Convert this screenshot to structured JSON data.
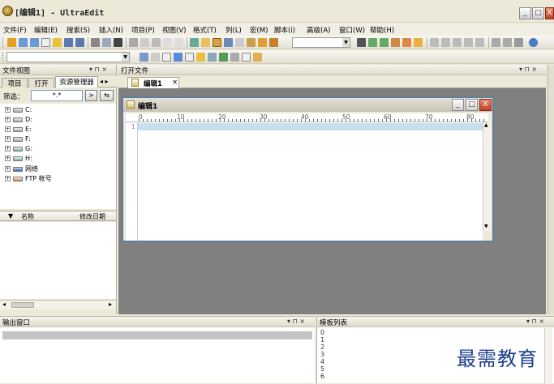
{
  "window": {
    "title": "[编辑1] - UltraEdit",
    "controls": [
      "_",
      "□",
      "X"
    ]
  },
  "menu": [
    "文件(F)",
    "编辑(E)",
    "搜索(S)",
    "插入(N)",
    "项目(P)",
    "视图(V)",
    "格式(T)",
    "列(L)",
    "宏(M)",
    "脚本(i)",
    "高级(A)",
    "窗口(W)",
    "帮助(H)"
  ],
  "file_view": {
    "title": "文件视图",
    "pin": "▾ ⊓ ×",
    "tabs": [
      "项目",
      "打开",
      "资源管理器"
    ],
    "tab_arrows": "◂ ▸",
    "filter_label": "筛选：",
    "filter_value": "*.*",
    "filter_go": ">",
    "filter_browse": "⇆",
    "tree": [
      {
        "label": "C:",
        "icon": "drive-icon"
      },
      {
        "label": "D:",
        "icon": "drive-icon"
      },
      {
        "label": "E:",
        "icon": "drive-icon"
      },
      {
        "label": "F:",
        "icon": "drive-icon"
      },
      {
        "label": "G:",
        "icon": "cd-drive-icon"
      },
      {
        "label": "H:",
        "icon": "cd-drive-icon"
      },
      {
        "label": "网络",
        "icon": "network-icon"
      },
      {
        "label": "FTP 帐号",
        "icon": "ftp-icon"
      }
    ],
    "list_headers": [
      "▼",
      "名称",
      "修改日期"
    ],
    "hscroll": [
      "◂",
      "▸"
    ]
  },
  "open_files": {
    "title": "打开文件",
    "pin": "▾ ⊓ ×",
    "tab_label": "编辑1",
    "tab_close": "×"
  },
  "editor": {
    "title": "编辑1",
    "controls": [
      "_",
      "□",
      "X"
    ],
    "ruler": [
      "0",
      "10",
      "20",
      "30",
      "40",
      "50",
      "60",
      "70",
      "80"
    ],
    "lines": [
      "1"
    ]
  },
  "output": {
    "title": "输出窗口",
    "pin": "▾ ⊓ ×"
  },
  "templates": {
    "title": "模板列表",
    "pin": "▾ ⊓ ×",
    "items": [
      "0",
      "1",
      "2",
      "3",
      "4",
      "5",
      "6"
    ]
  },
  "watermark": "最需教育"
}
